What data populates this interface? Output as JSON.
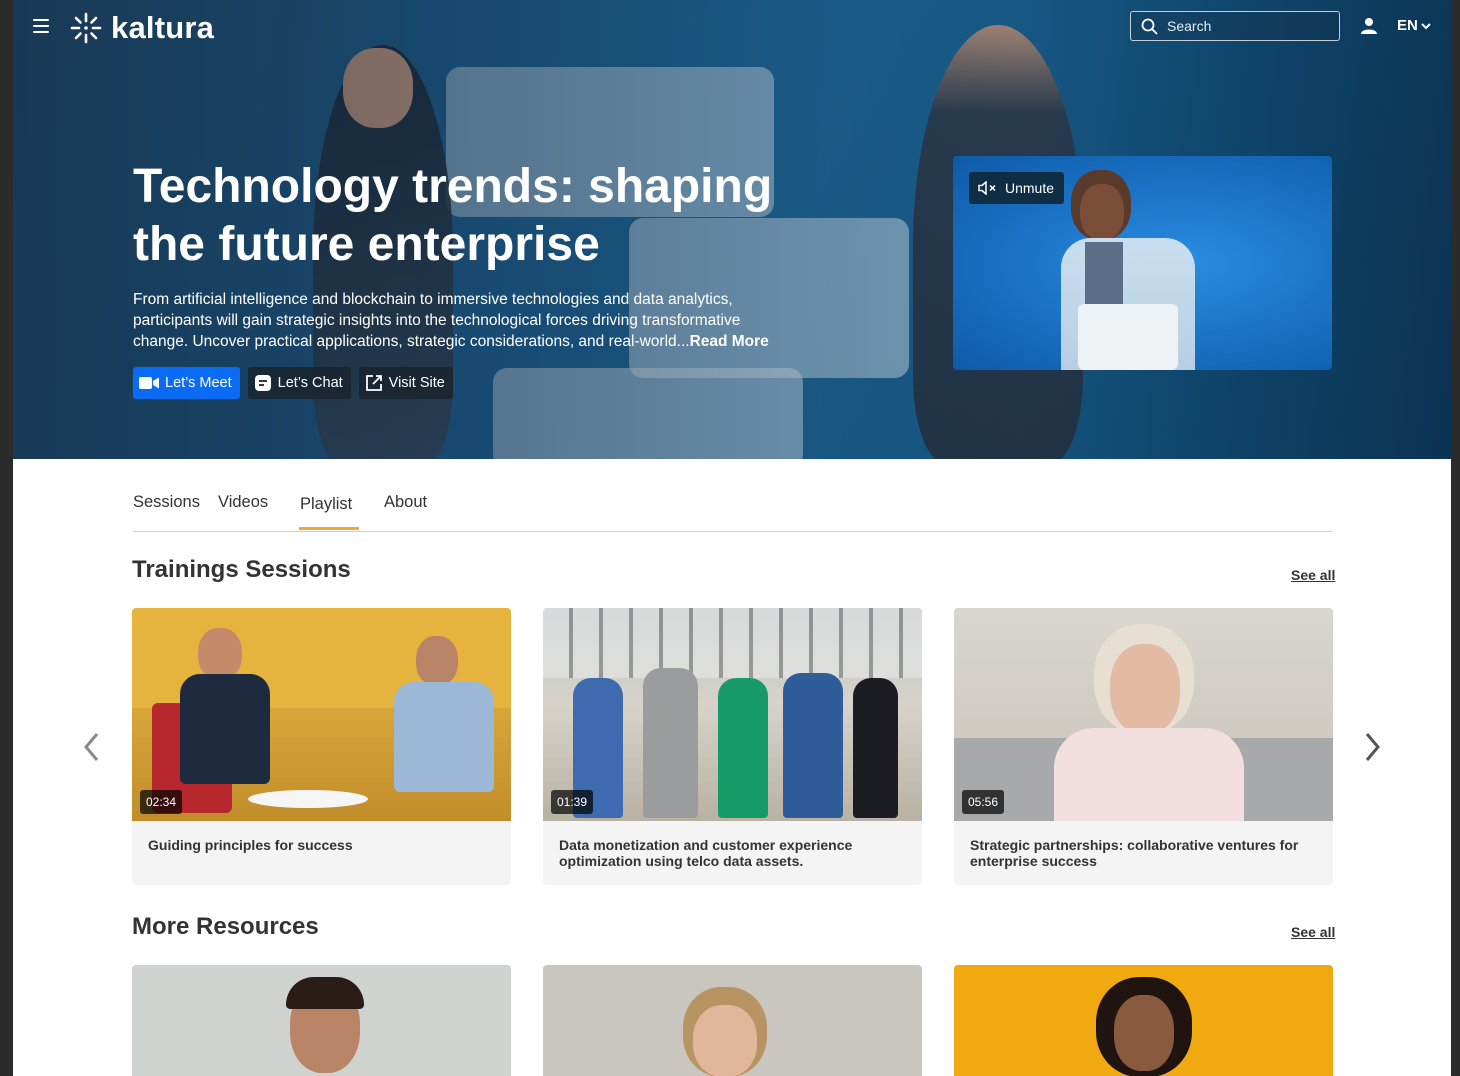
{
  "header": {
    "logo_text": "kaltura",
    "search_placeholder": "Search",
    "language": "EN"
  },
  "hero": {
    "title": "Technology trends: shaping the future enterprise",
    "description": "From artificial intelligence and blockchain to immersive technologies and data analytics, participants will gain strategic insights into the technological forces driving transformative change. Uncover practical applications, strategic considerations, and real-world...",
    "read_more": "Read More",
    "buttons": {
      "meet": "Let’s Meet",
      "chat": "Let’s Chat",
      "visit": "Visit Site"
    },
    "video": {
      "unmute_label": "Unmute"
    }
  },
  "tabs": [
    {
      "label": "Sessions"
    },
    {
      "label": "Videos"
    },
    {
      "label": "Playlist"
    },
    {
      "label": "About"
    }
  ],
  "sections": [
    {
      "title": "Trainings Sessions",
      "see_all": "See all",
      "cards": [
        {
          "duration": "02:34",
          "title": "Guiding principles for success"
        },
        {
          "duration": "01:39",
          "title": "Data monetization and customer experience optimization using telco data assets."
        },
        {
          "duration": "05:56",
          "title": "Strategic partnerships: collaborative ventures for enterprise success"
        }
      ]
    },
    {
      "title": "More Resources",
      "see_all": "See all"
    }
  ],
  "colors": {
    "primary_button": "#0a6cf5",
    "tab_underline": "#f2a53a"
  }
}
